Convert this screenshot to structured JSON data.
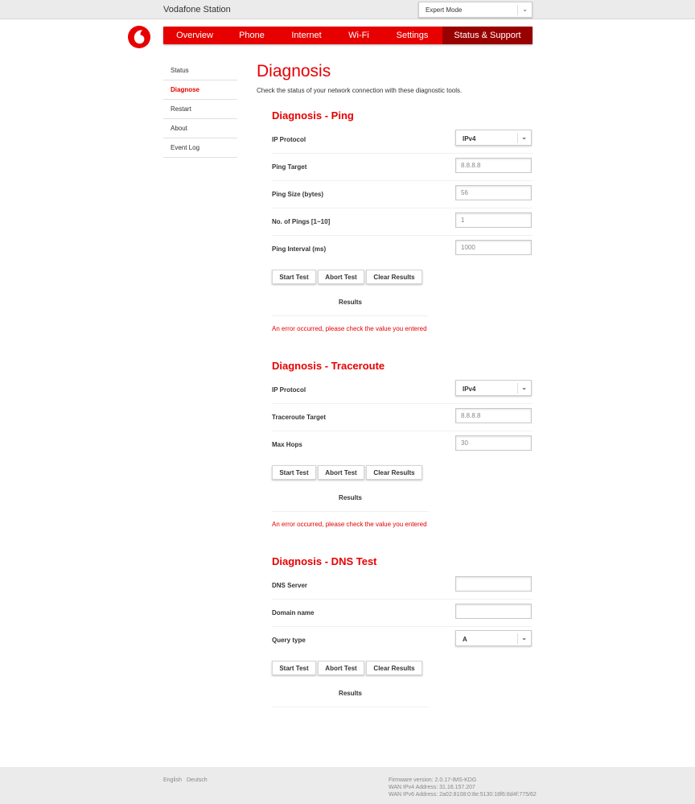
{
  "header": {
    "brand": "Vodafone Station",
    "mode_select": {
      "value": "Expert Mode"
    }
  },
  "nav": {
    "items": [
      {
        "label": "Overview",
        "active": false
      },
      {
        "label": "Phone",
        "active": false
      },
      {
        "label": "Internet",
        "active": false
      },
      {
        "label": "Wi-Fi",
        "active": false
      },
      {
        "label": "Settings",
        "active": false
      },
      {
        "label": "Status & Support",
        "active": true
      }
    ]
  },
  "sidebar": {
    "items": [
      {
        "label": "Status",
        "active": false
      },
      {
        "label": "Diagnose",
        "active": true
      },
      {
        "label": "Restart",
        "active": false
      },
      {
        "label": "About",
        "active": false
      },
      {
        "label": "Event Log",
        "active": false
      }
    ]
  },
  "page": {
    "title": "Diagnosis",
    "description": "Check the status of your network connection with these diagnostic tools."
  },
  "buttons": {
    "start": "Start Test",
    "abort": "Abort Test",
    "clear": "Clear Results"
  },
  "results_label": "Results",
  "ping": {
    "title": "Diagnosis - Ping",
    "ip_protocol": {
      "label": "IP Protocol",
      "value": "IPv4"
    },
    "target": {
      "label": "Ping Target",
      "value": "8.8.8.8"
    },
    "size": {
      "label": "Ping Size (bytes)",
      "value": "56"
    },
    "count": {
      "label": "No. of Pings [1~10]",
      "value": "1"
    },
    "interval": {
      "label": "Ping Interval (ms)",
      "value": "1000"
    },
    "error": "An error occurred, please check the value you entered"
  },
  "traceroute": {
    "title": "Diagnosis - Traceroute",
    "ip_protocol": {
      "label": "IP Protocol",
      "value": "IPv4"
    },
    "target": {
      "label": "Traceroute Target",
      "value": "8.8.8.8"
    },
    "max_hops": {
      "label": "Max Hops",
      "value": "30"
    },
    "error": "An error occurred, please check the value you entered"
  },
  "dns": {
    "title": "Diagnosis - DNS Test",
    "server": {
      "label": "DNS Server",
      "value": ""
    },
    "domain": {
      "label": "Domain name",
      "value": ""
    },
    "query_type": {
      "label": "Query type",
      "value": "A"
    }
  },
  "footer": {
    "languages": [
      "English",
      "Deutsch"
    ],
    "firmware": "Firmware version: 2.0.17-IMS-KDG",
    "wan_ipv4": "WAN IPv4 Address: 31.16.157.207",
    "wan_ipv6": "WAN IPv6 Address: 2a02:8108:0:8e:5130:18f6:8d4f:775/62"
  },
  "colors": {
    "brand_red": "#e60000",
    "active_nav": "#990000"
  }
}
